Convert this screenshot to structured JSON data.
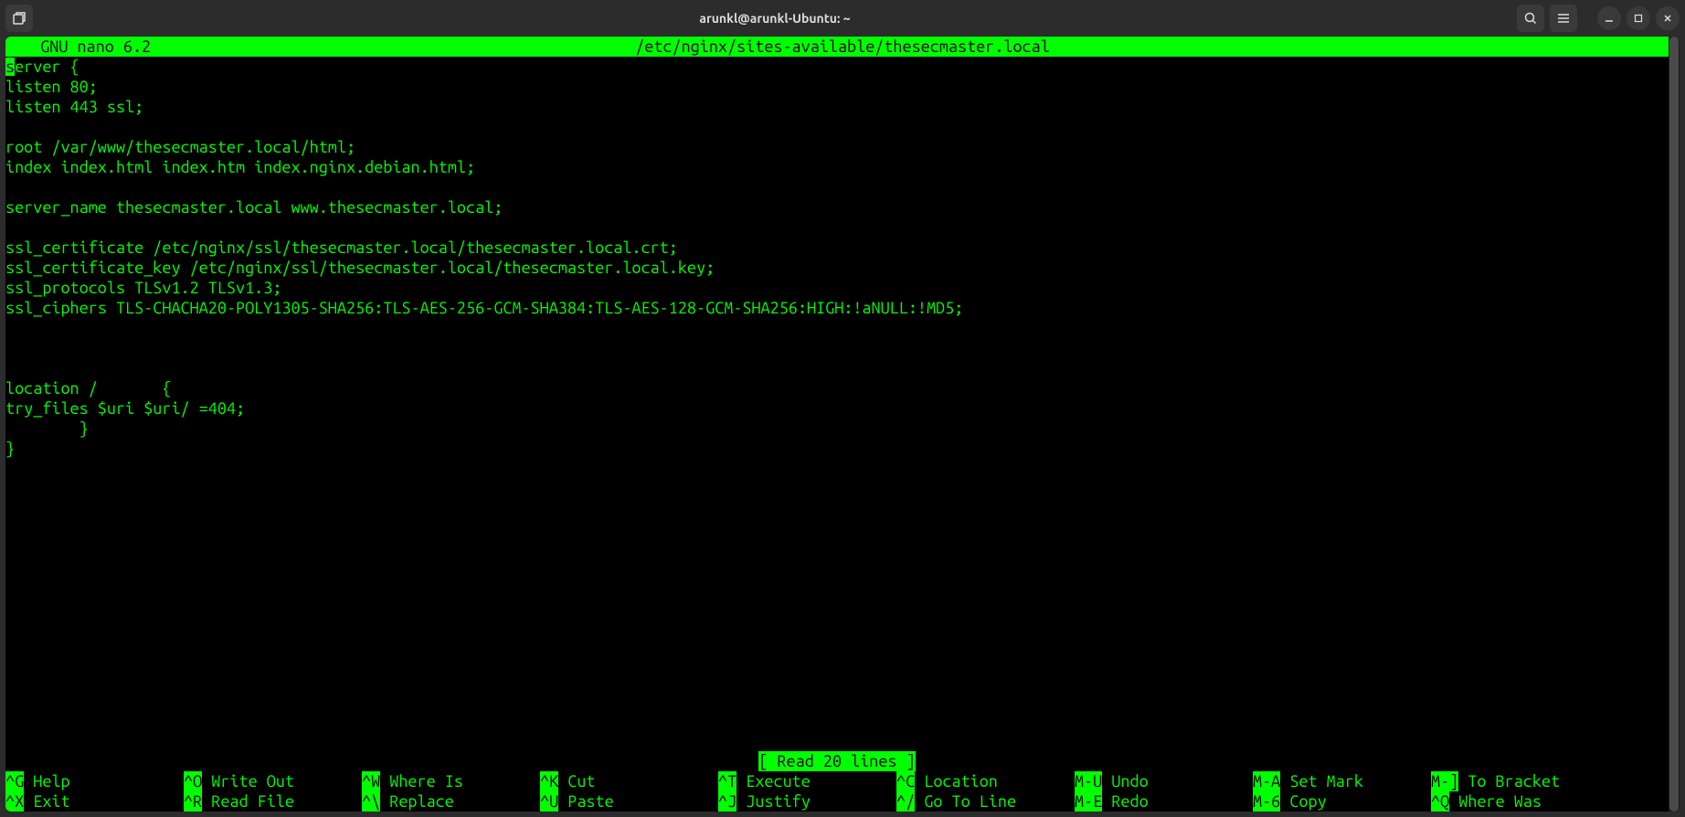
{
  "window": {
    "title": "arunkl@arunkl-Ubuntu: ~"
  },
  "editor": {
    "app_name": "  GNU nano 6.2",
    "file_path": "/etc/nginx/sites-available/thesecmaster.local",
    "status": "[ Read 20 lines ]",
    "content_lines": [
      "server {",
      "listen 80;",
      "listen 443 ssl;",
      "",
      "root /var/www/thesecmaster.local/html;",
      "index index.html index.htm index.nginx.debian.html;",
      "",
      "server_name thesecmaster.local www.thesecmaster.local;",
      "",
      "ssl_certificate /etc/nginx/ssl/thesecmaster.local/thesecmaster.local.crt;",
      "ssl_certificate_key /etc/nginx/ssl/thesecmaster.local/thesecmaster.local.key;",
      "ssl_protocols TLSv1.2 TLSv1.3;",
      "ssl_ciphers TLS-CHACHA20-POLY1305-SHA256:TLS-AES-256-GCM-SHA384:TLS-AES-128-GCM-SHA256:HIGH:!aNULL:!MD5;",
      "",
      "",
      "",
      "location /       {",
      "try_files $uri $uri/ =404;",
      "        }",
      "}"
    ]
  },
  "shortcuts": {
    "row1": [
      {
        "key": "^G",
        "label": " Help"
      },
      {
        "key": "^O",
        "label": " Write Out"
      },
      {
        "key": "^W",
        "label": " Where Is"
      },
      {
        "key": "^K",
        "label": " Cut"
      },
      {
        "key": "^T",
        "label": " Execute"
      },
      {
        "key": "^C",
        "label": " Location"
      },
      {
        "key": "M-U",
        "label": " Undo"
      },
      {
        "key": "M-A",
        "label": " Set Mark"
      },
      {
        "key": "M-]",
        "label": " To Bracket"
      }
    ],
    "row2": [
      {
        "key": "^X",
        "label": " Exit"
      },
      {
        "key": "^R",
        "label": " Read File"
      },
      {
        "key": "^\\",
        "label": " Replace"
      },
      {
        "key": "^U",
        "label": " Paste"
      },
      {
        "key": "^J",
        "label": " Justify"
      },
      {
        "key": "^/",
        "label": " Go To Line"
      },
      {
        "key": "M-E",
        "label": " Redo"
      },
      {
        "key": "M-6",
        "label": " Copy"
      },
      {
        "key": "^Q",
        "label": " Where Was"
      }
    ]
  }
}
